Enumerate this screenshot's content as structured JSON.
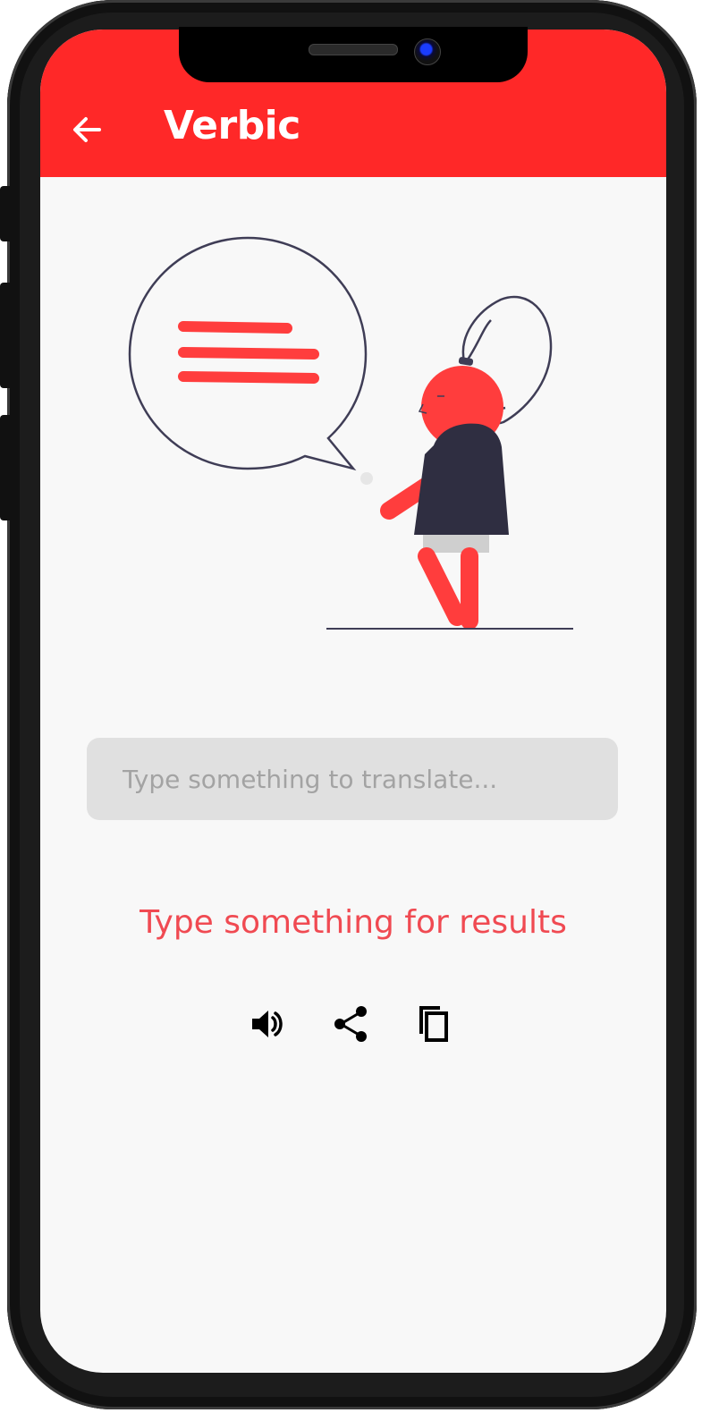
{
  "app": {
    "title": "Verbic"
  },
  "colors": {
    "accent": "#ff2828",
    "result_text": "#f04a52",
    "input_bg": "#e0e0e0",
    "screen_bg": "#f8f8f8"
  },
  "header": {
    "back_icon": "arrow-left-icon",
    "title": "Verbic"
  },
  "illustration": {
    "name": "person-speech-bubble-illustration"
  },
  "translate_input": {
    "value": "",
    "placeholder": "Type something to translate..."
  },
  "result": {
    "text": "Type something for results"
  },
  "actions": [
    {
      "icon": "speaker-icon",
      "label": "speak"
    },
    {
      "icon": "share-icon",
      "label": "share"
    },
    {
      "icon": "copy-icon",
      "label": "copy"
    }
  ]
}
